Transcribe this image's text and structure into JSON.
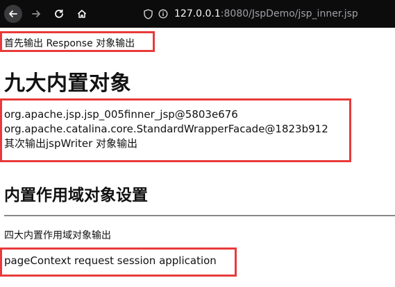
{
  "browser": {
    "url_host": "127.0.0.1",
    "url_rest": ":8080/JspDemo/jsp_inner.jsp"
  },
  "page": {
    "response_output": "首先输出 Response 对象输出",
    "title": "九大内置对象",
    "object_lines": [
      "org.apache.jsp.jsp_005finner_jsp@5803e676",
      "org.apache.catalina.core.StandardWrapperFacade@1823b912",
      "其次输出jspWriter 对象输出"
    ],
    "section_title": "内置作用域对象设置",
    "scope_output_label": "四大内置作用域对象输出",
    "scope_values": "pageContext request session application"
  },
  "colors": {
    "highlight_border": "#e83a3a",
    "toolbar_bg": "#0c0c0d"
  }
}
